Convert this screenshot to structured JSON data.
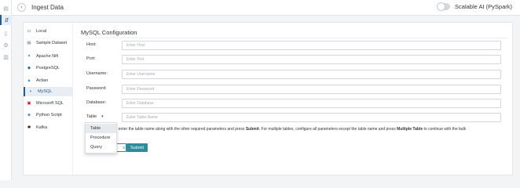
{
  "rail": {
    "items": [
      {
        "icon": "grid-icon",
        "glyph": "▤",
        "active": false
      },
      {
        "icon": "ingest-icon",
        "glyph": "⇵",
        "active": true
      },
      {
        "icon": "document-icon",
        "glyph": "▯",
        "active": false
      },
      {
        "icon": "settings-icon",
        "glyph": "⚙",
        "active": false
      },
      {
        "icon": "chart-icon",
        "glyph": "▥",
        "active": false
      }
    ]
  },
  "header": {
    "back_glyph": "‹",
    "title": "Ingest Data",
    "toggle_label": "Scalable AI (PySpark)",
    "toggle_on": false
  },
  "sources": {
    "items": [
      {
        "label": "Local",
        "glyph": "▭",
        "color": "#5b6b7b"
      },
      {
        "label": "Sample Dataset",
        "glyph": "▤",
        "color": "#5b6b7b"
      },
      {
        "label": "Apache Nifi",
        "glyph": "✦",
        "color": "#3a7fc0"
      },
      {
        "label": "PostgreSQL",
        "glyph": "◆",
        "color": "#336791"
      },
      {
        "label": "Actian",
        "glyph": "▲",
        "color": "#1f8fd1"
      },
      {
        "label": "MySQL",
        "glyph": "◗",
        "color": "#00758f"
      },
      {
        "label": "Microsoft SQL",
        "glyph": "▣",
        "color": "#c8102e"
      },
      {
        "label": "Python Script",
        "glyph": "◈",
        "color": "#3776ab"
      },
      {
        "label": "Kafka",
        "glyph": "✱",
        "color": "#222222"
      }
    ],
    "active_index": 5
  },
  "form": {
    "title": "MySQL Configuration",
    "fields": [
      {
        "label": "Host:",
        "placeholder": "Enter Host"
      },
      {
        "label": "Port:",
        "placeholder": "Enter Port"
      },
      {
        "label": "Username:",
        "placeholder": "Enter Username"
      },
      {
        "label": "Password:",
        "placeholder": "Enter Password"
      },
      {
        "label": "Database:",
        "placeholder": "Enter Database"
      }
    ],
    "table_select": {
      "label": "Table",
      "caret": "▾",
      "placeholder": "Enter Table Name"
    },
    "info": {
      "part1": ", enter the table name along with the other required parameters and press ",
      "submit_word": "Submit",
      "part2": ". For multiple tables, configure all parameters except the table name and press ",
      "multiple_word": "Multiple Table",
      "part3": " to continue with the bulk"
    },
    "hidden_button_text": "s",
    "submit_label": "Submit"
  },
  "dropdown": {
    "options": [
      "Table",
      "Procedure",
      "Query"
    ],
    "selected_index": 0
  },
  "colors": {
    "accent": "#2e8c9b",
    "active_nav": "#2a5a8a"
  }
}
